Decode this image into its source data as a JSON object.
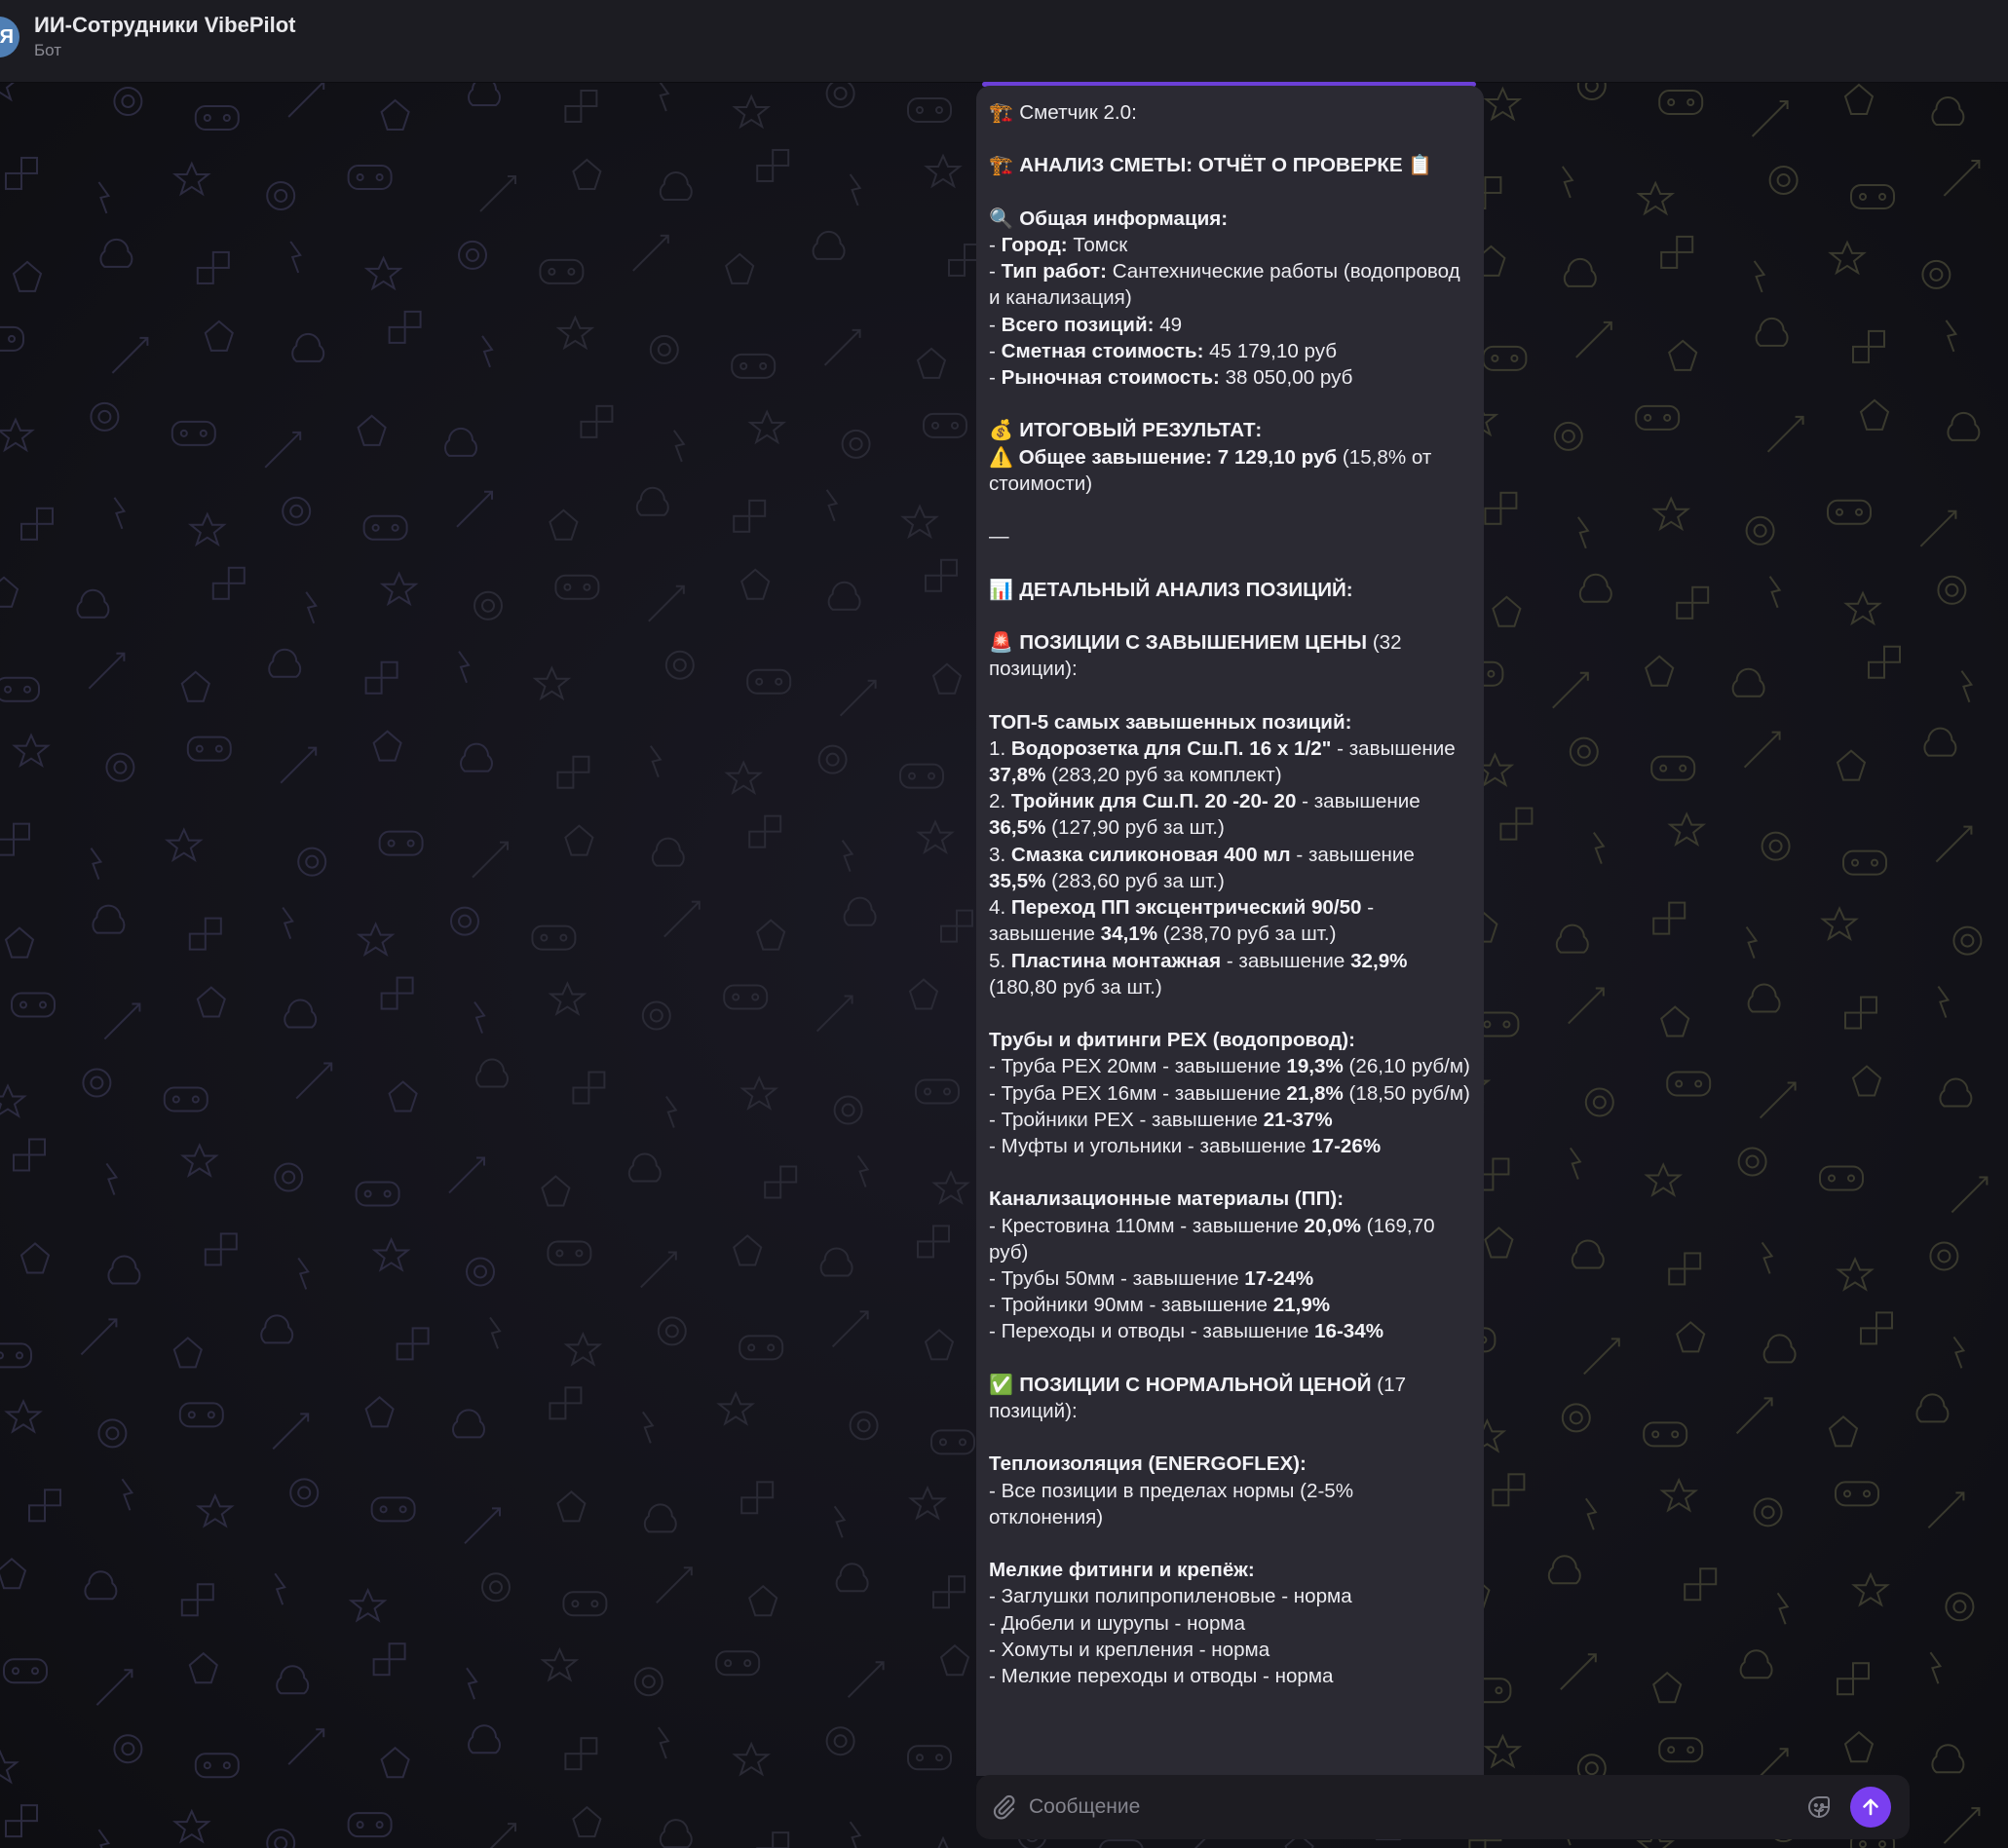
{
  "header": {
    "avatar_letter": "Я",
    "title": "ИИ-Сотрудники VibePilot",
    "subtitle": "Бот"
  },
  "colors": {
    "accent": "#7a3ff0",
    "bubble": "#2b2a33",
    "header": "#1c1c22"
  },
  "message": {
    "lines": [
      [
        {
          "t": "🏗️ ",
          "e": true
        },
        {
          "t": "Сметчик 2.0:"
        }
      ],
      [],
      [
        {
          "t": "🏗️ ",
          "e": true
        },
        {
          "t": "АНАЛИЗ СМЕТЫ: ОТЧЁТ О ПРОВЕРКЕ ",
          "b": true
        },
        {
          "t": "📋",
          "e": true
        }
      ],
      [],
      [
        {
          "t": "🔍 ",
          "e": true
        },
        {
          "t": "Общая информация:",
          "b": true
        }
      ],
      [
        {
          "t": "- "
        },
        {
          "t": "Город:",
          "b": true
        },
        {
          "t": " Томск"
        }
      ],
      [
        {
          "t": "- "
        },
        {
          "t": "Тип работ:",
          "b": true
        },
        {
          "t": " Сантехнические работы (водопровод и канализация)"
        }
      ],
      [
        {
          "t": "- "
        },
        {
          "t": "Всего позиций:",
          "b": true
        },
        {
          "t": " 49"
        }
      ],
      [
        {
          "t": "- "
        },
        {
          "t": "Сметная стоимость:",
          "b": true
        },
        {
          "t": " 45 179,10 руб"
        }
      ],
      [
        {
          "t": "- "
        },
        {
          "t": "Рыночная стоимость:",
          "b": true
        },
        {
          "t": " 38 050,00 руб"
        }
      ],
      [],
      [
        {
          "t": "💰 ",
          "e": true
        },
        {
          "t": "ИТОГОВЫЙ РЕЗУЛЬТАТ:",
          "b": true
        }
      ],
      [
        {
          "t": "⚠️",
          "e": true
        },
        {
          "t": " Общее завышение: 7 129,10 руб",
          "b": true
        },
        {
          "t": " (15,8% от стоимости)"
        }
      ],
      [],
      [
        {
          "t": "—"
        }
      ],
      [],
      [
        {
          "t": "📊 ",
          "e": true
        },
        {
          "t": "ДЕТАЛЬНЫЙ АНАЛИЗ ПОЗИЦИЙ:",
          "b": true
        }
      ],
      [],
      [
        {
          "t": "🚨 ",
          "e": true
        },
        {
          "t": "ПОЗИЦИИ С ЗАВЫШЕНИЕМ ЦЕНЫ",
          "b": true
        },
        {
          "t": " (32 позиции):"
        }
      ],
      [],
      [
        {
          "t": "ТОП-5 самых завышенных позиций:",
          "b": true
        }
      ],
      [
        {
          "t": "1. "
        },
        {
          "t": "Водорозетка для Сш.П. 16 х 1/2\"",
          "b": true
        },
        {
          "t": " - завышение "
        },
        {
          "t": "37,8%",
          "b": true
        },
        {
          "t": " (283,20 руб за комплект)"
        }
      ],
      [
        {
          "t": "2. "
        },
        {
          "t": "Тройник для Сш.П. 20 -20- 20",
          "b": true
        },
        {
          "t": " - завышение "
        },
        {
          "t": "36,5%",
          "b": true
        },
        {
          "t": " (127,90 руб за шт.)"
        }
      ],
      [
        {
          "t": "3. "
        },
        {
          "t": "Смазка силиконовая 400 мл",
          "b": true
        },
        {
          "t": " - завышение "
        },
        {
          "t": "35,5%",
          "b": true
        },
        {
          "t": " (283,60 руб за шт.)"
        }
      ],
      [
        {
          "t": "4. "
        },
        {
          "t": "Переход ПП эксцентрический 90/50",
          "b": true
        },
        {
          "t": " - завышение "
        },
        {
          "t": "34,1%",
          "b": true
        },
        {
          "t": " (238,70 руб за шт.)"
        }
      ],
      [
        {
          "t": "5. "
        },
        {
          "t": "Пластина монтажная",
          "b": true
        },
        {
          "t": " - завышение "
        },
        {
          "t": "32,9%",
          "b": true
        },
        {
          "t": " (180,80 руб за шт.)"
        }
      ],
      [],
      [
        {
          "t": "Трубы и фитинги PEX (водопровод):",
          "b": true
        }
      ],
      [
        {
          "t": "- Труба PEX 20мм - завышение "
        },
        {
          "t": "19,3%",
          "b": true
        },
        {
          "t": " (26,10 руб/м)"
        }
      ],
      [
        {
          "t": "- Труба PEX 16мм - завышение "
        },
        {
          "t": "21,8%",
          "b": true
        },
        {
          "t": " (18,50 руб/м)"
        }
      ],
      [
        {
          "t": "- Тройники PEX - завышение "
        },
        {
          "t": "21-37%",
          "b": true
        }
      ],
      [
        {
          "t": "- Муфты и угольники - завышение "
        },
        {
          "t": "17-26%",
          "b": true
        }
      ],
      [],
      [
        {
          "t": "Канализационные материалы (ПП):",
          "b": true
        }
      ],
      [
        {
          "t": "- Крестовина 110мм - завышение "
        },
        {
          "t": "20,0%",
          "b": true
        },
        {
          "t": " (169,70 руб)"
        }
      ],
      [
        {
          "t": "- Трубы 50мм - завышение "
        },
        {
          "t": "17-24%",
          "b": true
        }
      ],
      [
        {
          "t": "- Тройники 90мм - завышение "
        },
        {
          "t": "21,9%",
          "b": true
        }
      ],
      [
        {
          "t": "- Переходы и отводы - завышение "
        },
        {
          "t": "16-34%",
          "b": true
        }
      ],
      [],
      [
        {
          "t": "✅ ",
          "e": true
        },
        {
          "t": "ПОЗИЦИИ С НОРМАЛЬНОЙ ЦЕНОЙ",
          "b": true
        },
        {
          "t": " (17 позиций):"
        }
      ],
      [],
      [
        {
          "t": "Теплоизоляция (ENERGOFLEX):",
          "b": true
        }
      ],
      [
        {
          "t": "- Все позиции в пределах нормы (2-5% отклонения)"
        }
      ],
      [],
      [
        {
          "t": "Мелкие фитинги и крепёж:",
          "b": true
        }
      ],
      [
        {
          "t": "- Заглушки полипропиленовые - норма"
        }
      ],
      [
        {
          "t": "- Дюбели и шурупы - норма"
        }
      ],
      [
        {
          "t": "- Хомуты и крепления - норма"
        }
      ],
      [
        {
          "t": "- Мелкие переходы и отводы - норма"
        }
      ]
    ]
  },
  "composer": {
    "placeholder": "Сообщение",
    "attach_icon": "paperclip-icon",
    "sticker_icon": "sticker-icon",
    "send_icon": "arrow-up-icon"
  }
}
